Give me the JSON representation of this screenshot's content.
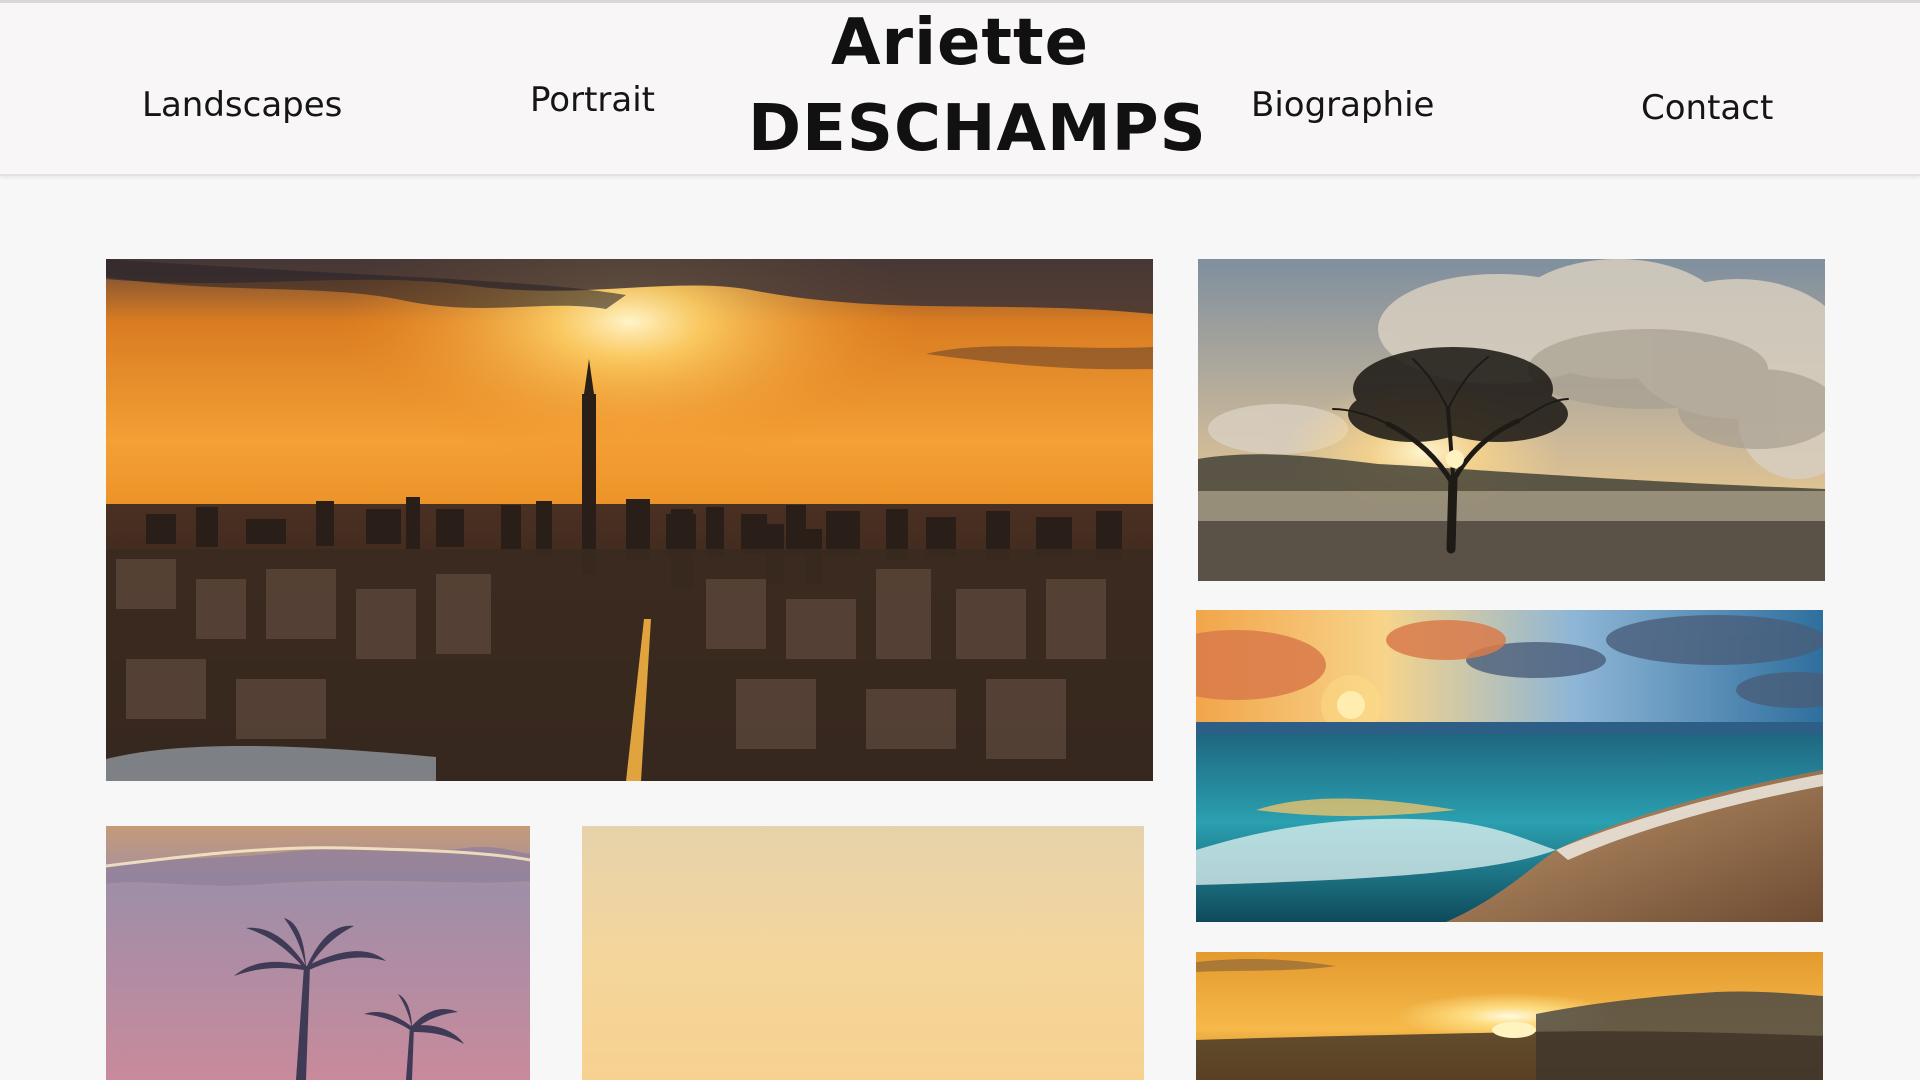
{
  "nav": {
    "landscapes": "Landscapes",
    "portrait": "Portrait",
    "biographie": "Biographie",
    "contact": "Contact"
  },
  "brand": {
    "first_name": "Ariette",
    "last_name": "DESCHAMPS"
  },
  "gallery": {
    "photos": [
      {
        "subject": "city skyline at sunset",
        "icon": "city-sunset-photo"
      },
      {
        "subject": "lone tree at sunrise",
        "icon": "tree-sunrise-photo"
      },
      {
        "subject": "ocean waves on beach at sunset",
        "icon": "beach-waves-photo"
      },
      {
        "subject": "palm trees at dusk",
        "icon": "palm-dusk-photo"
      },
      {
        "subject": "pale golden sky",
        "icon": "golden-sky-photo"
      },
      {
        "subject": "sun setting over horizon",
        "icon": "sunset-horizon-photo"
      }
    ]
  },
  "colors": {
    "background": "#f8f7f8",
    "header_background": "#f8f6f7",
    "text": "#111111",
    "sunset_orange": "#f0901c"
  }
}
